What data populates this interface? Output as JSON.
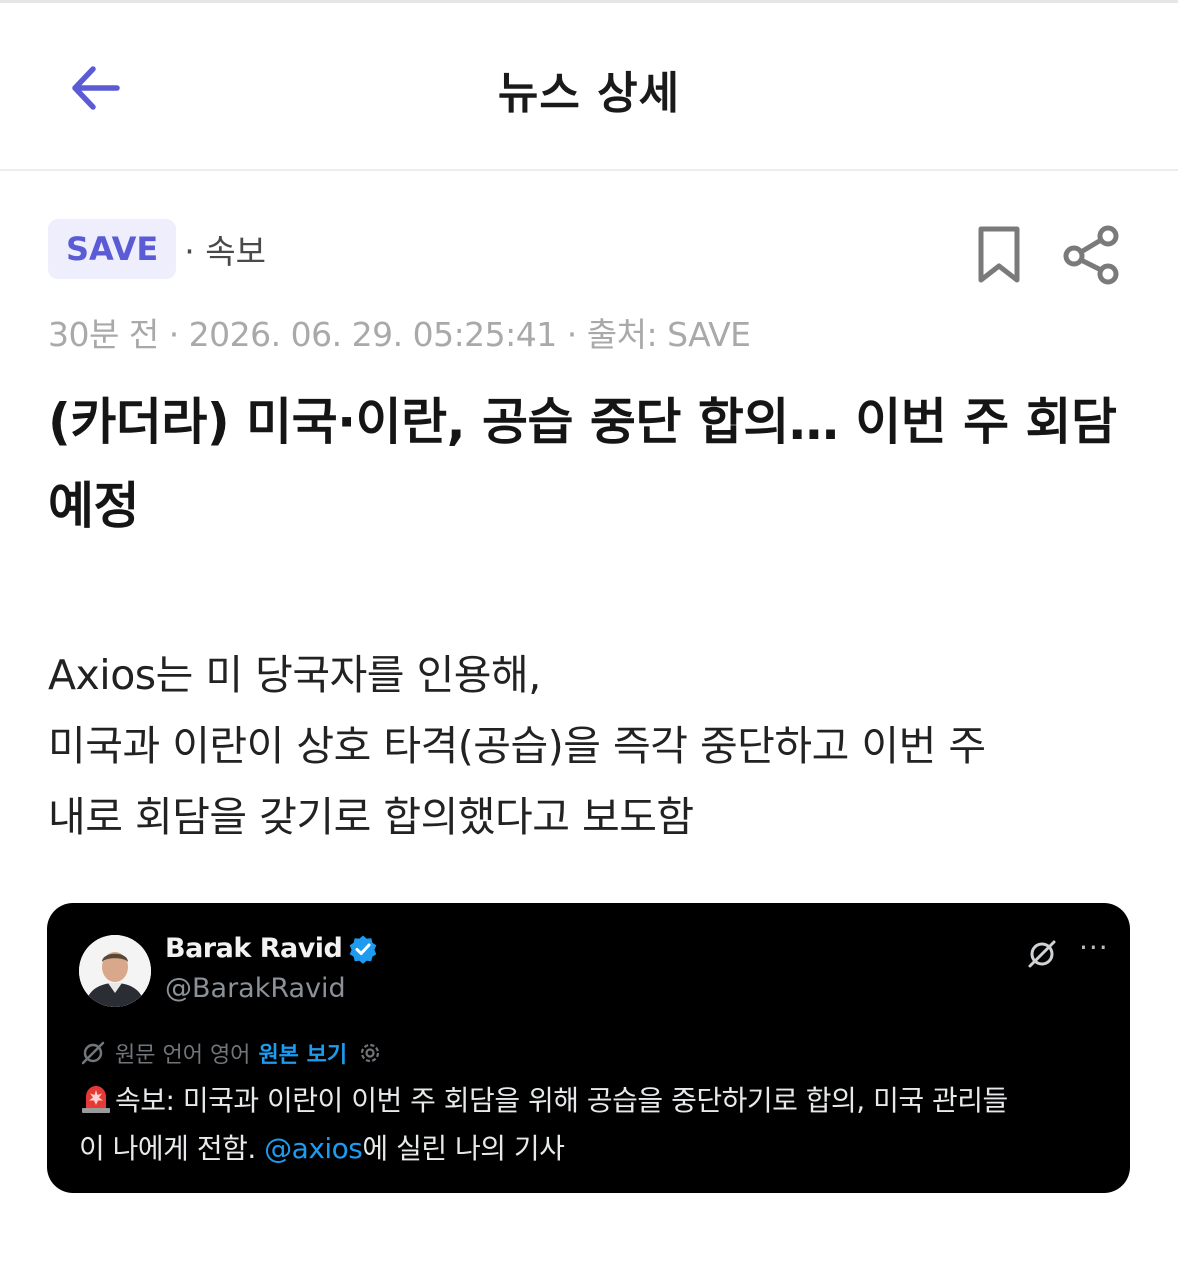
{
  "header": {
    "title": "뉴스 상세",
    "back_icon": "arrow-left-icon",
    "accent_color": "#5b5bd6"
  },
  "meta": {
    "source_badge": "SAVE",
    "category": "· 속보",
    "date_line": "30분 전 · 2026. 06. 29. 05:25:41 · 출처: SAVE",
    "bookmark_icon": "bookmark-icon",
    "share_icon": "share-icon"
  },
  "article": {
    "title": "(카더라) 미국·이란, 공습 중단 합의… 이번 주 회담 예정",
    "body_lines": [
      "Axios는 미 당국자를 인용해,",
      "미국과 이란이 상호 타격(공습)을 즉각 중단하고 이번 주",
      "내로 회담을 갖기로 합의했다고 보도함"
    ]
  },
  "tweet": {
    "name": "Barak Ravid",
    "handle": "@BarakRavid",
    "verified_icon": "verified-badge-icon",
    "grok_icon": "grok-icon",
    "more_label": "···",
    "translate_note": "원문 언어 영어",
    "view_original": "원본 보기",
    "text_line1": "속보: 미국과 이란이 이번 주 회담을 위해 공습을 중단하기로 합의, 미국 관리들",
    "text_line2_pre": "이 나에게 전함.",
    "mention": "@axios",
    "text_line2_post": "에 실린 나의 기사",
    "link_color": "#1d9bf0",
    "background_color": "#000000"
  }
}
